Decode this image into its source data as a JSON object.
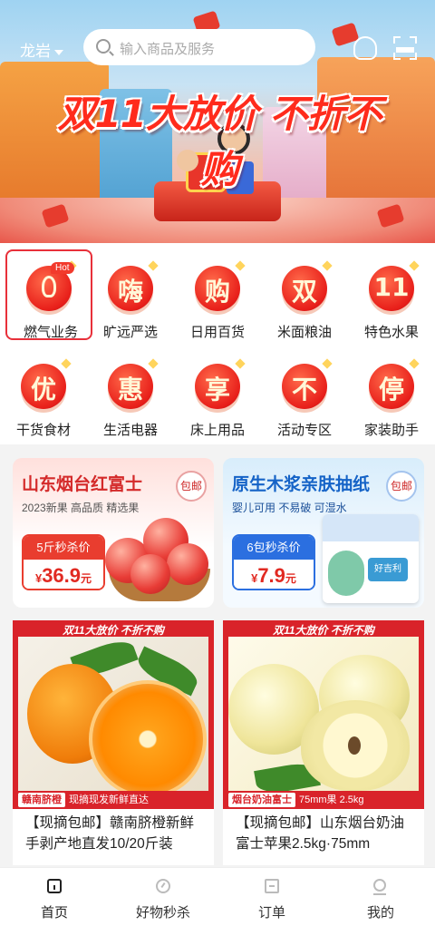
{
  "header": {
    "location": "龙岩",
    "search_placeholder": "输入商品及服务"
  },
  "banner": {
    "title": "双11大放价 不折不购"
  },
  "categories": [
    {
      "label": "燃气业务",
      "glyph": "",
      "hot": "Hot",
      "selected": true
    },
    {
      "label": "旷远严选",
      "glyph": "嗨"
    },
    {
      "label": "日用百货",
      "glyph": "购"
    },
    {
      "label": "米面粮油",
      "glyph": "双"
    },
    {
      "label": "特色水果",
      "glyph": "11"
    },
    {
      "label": "干货食材",
      "glyph": "优"
    },
    {
      "label": "生活电器",
      "glyph": "惠"
    },
    {
      "label": "床上用品",
      "glyph": "享"
    },
    {
      "label": "活动专区",
      "glyph": "不"
    },
    {
      "label": "家装助手",
      "glyph": "停"
    }
  ],
  "promos": [
    {
      "title": "山东烟台红富士",
      "subtitle": "2023新果 高品质 精选果",
      "badge": "包邮",
      "tag": "5斤秒杀价",
      "currency": "¥",
      "price": "36.9",
      "unit": "元"
    },
    {
      "title": "原生木浆亲肤抽纸",
      "subtitle": "婴儿可用 不易破 可湿水",
      "badge": "包邮",
      "tag": "6包秒杀价",
      "currency": "¥",
      "price": "7.9",
      "unit": "元",
      "product_label": "好吉利"
    }
  ],
  "products": [
    {
      "frame_header": "双11大放价 不折不购",
      "caption_pill": "赣南脐橙",
      "caption": "现摘现发新鲜直达",
      "name": "【现摘包邮】赣南脐橙新鲜手剥产地直发10/20斤装"
    },
    {
      "frame_header": "双11大放价 不折不购",
      "caption_pill": "烟台奶油富士",
      "caption": "75mm果 2.5kg",
      "name": "【现摘包邮】山东烟台奶油富士苹果2.5kg·75mm"
    }
  ],
  "nav": [
    {
      "label": "首页",
      "icon": "home-icon",
      "active": true
    },
    {
      "label": "好物秒杀",
      "icon": "clock-icon"
    },
    {
      "label": "订单",
      "icon": "order-icon"
    },
    {
      "label": "我的",
      "icon": "user-icon"
    }
  ],
  "colors": {
    "accent_red": "#e8303a",
    "price_red": "#e12a22",
    "promo_blue": "#2b6fe0"
  }
}
